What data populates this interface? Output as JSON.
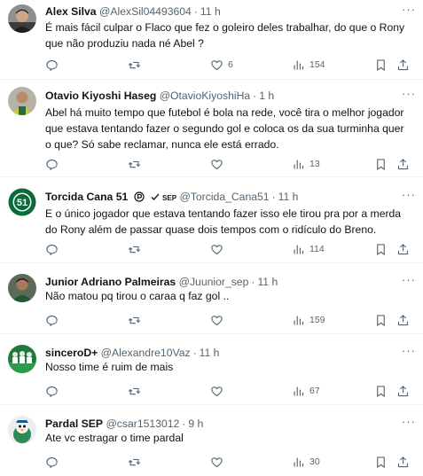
{
  "tweets": [
    {
      "name": "Alex Silva",
      "handle": "@AlexSil04493604",
      "time": "11 h",
      "text": "É mais fácil culpar o Flaco que fez o goleiro deles trabalhar, do que o Rony que não produziu nada né Abel ?",
      "replies": "",
      "retweets": "",
      "likes": "6",
      "views": "154",
      "avatar_icon": "person-photo-avatar"
    },
    {
      "name": "Otavio Kiyoshi Haseg",
      "handle": "@OtavioKiyoshiHa",
      "time": "1 h",
      "text": "Abel há muito tempo que futebol é bola na rede, você tira o melhor jogador que estava tentando fazer o segundo gol e coloca os da sua turminha quer o que? Só sabe reclamar, nunca ele está errado.",
      "replies": "",
      "retweets": "",
      "likes": "",
      "views": "13",
      "avatar_icon": "person-photo-avatar"
    },
    {
      "name": "Torcida Cana 51",
      "badge": "SEP",
      "handle": "@Torcida_Cana51",
      "time": "11 h",
      "text": "E o único jogador que estava tentando fazer isso ele tirou pra por a merda do Rony além de passar quase dois tempos com o ridículo do Breno.",
      "replies": "",
      "retweets": "",
      "likes": "",
      "views": "114",
      "avatar_icon": "green-club-logo-avatar",
      "avatar_text": "51"
    },
    {
      "name": "Junior Adriano Palmeiras",
      "handle": "@Juunior_sep",
      "time": "11 h",
      "text": "Não matou pq tirou o caraa q faz gol ..",
      "replies": "",
      "retweets": "",
      "likes": "",
      "views": "159",
      "avatar_icon": "person-photo-avatar"
    },
    {
      "name": "sinceroD+",
      "handle": "@Alexandre10Vaz",
      "time": "11 h",
      "text": "Nosso time é ruim de mais",
      "replies": "",
      "retweets": "",
      "likes": "",
      "views": "67",
      "avatar_icon": "team-photo-avatar"
    },
    {
      "name": "Pardal SEP",
      "handle": "@csar1513012",
      "time": "9 h",
      "text": "Ate vc estragar o time pardal",
      "replies": "",
      "retweets": "",
      "likes": "",
      "views": "30",
      "avatar_icon": "cartoon-bird-avatar"
    }
  ],
  "colors": {
    "text_primary": "#0f1419",
    "text_secondary": "#536471",
    "divider": "#eff3f4",
    "club_green": "#0b6b3a"
  }
}
